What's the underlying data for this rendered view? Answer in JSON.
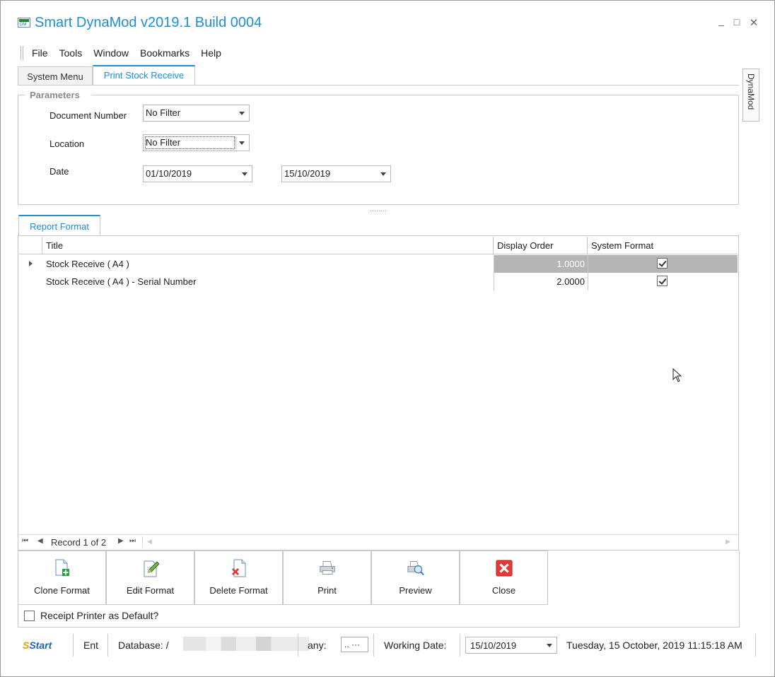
{
  "window": {
    "title": "Smart DynaMod v2019.1 Build 0004",
    "controls": {
      "minimize": "–",
      "maximize": "□",
      "close": "✕"
    }
  },
  "menu": [
    "File",
    "Tools",
    "Window",
    "Bookmarks",
    "Help"
  ],
  "tabs": [
    {
      "label": "System Menu",
      "active": false
    },
    {
      "label": "Print Stock Receive",
      "active": true
    }
  ],
  "side_dock": {
    "label": "DynaMod"
  },
  "parameters": {
    "legend": "Parameters",
    "document_number": {
      "label": "Document Number",
      "value": "No Filter"
    },
    "location": {
      "label": "Location",
      "value": "No Filter"
    },
    "date": {
      "label": "Date",
      "from": "01/10/2019",
      "to": "15/10/2019"
    }
  },
  "report_tab": {
    "label": "Report Format"
  },
  "grid": {
    "columns": {
      "title": "Title",
      "display_order": "Display Order",
      "system_format": "System Format"
    },
    "rows": [
      {
        "title": "Stock Receive ( A4 )",
        "display_order": "1.0000",
        "system_format": true,
        "selected": true
      },
      {
        "title": "Stock Receive ( A4 ) - Serial Number",
        "display_order": "2.0000",
        "system_format": true,
        "selected": false
      }
    ]
  },
  "navigator": {
    "first": "⏮",
    "prev": "◀",
    "next": "▶",
    "last": "⏭",
    "text": "Record 1 of 2"
  },
  "actions": {
    "clone": "Clone Format",
    "edit": "Edit Format",
    "delete": "Delete Format",
    "print": "Print",
    "preview": "Preview",
    "close": "Close"
  },
  "receipt_printer": {
    "label": "Receipt Printer as Default?",
    "checked": false
  },
  "statusbar": {
    "logo_prefix": "S",
    "logo_text": "Start",
    "entity": "Ent",
    "database_label": "Database: /",
    "company_label": "any:",
    "ellipsis_button": ".. ···",
    "working_date_label": "Working Date:",
    "working_date": "15/10/2019",
    "datetime": "Tuesday, 15 October, 2019 11:15:18 AM"
  },
  "colors": {
    "accent": "#1f8ed4",
    "selected_row": "#b5b5b5",
    "border": "#c9c9c9",
    "close_red": "#e53935"
  },
  "icons": [
    "app-icon",
    "clone-format-icon",
    "edit-format-icon",
    "delete-format-icon",
    "printer-icon",
    "preview-icon",
    "close-icon",
    "mouse-cursor-icon"
  ]
}
